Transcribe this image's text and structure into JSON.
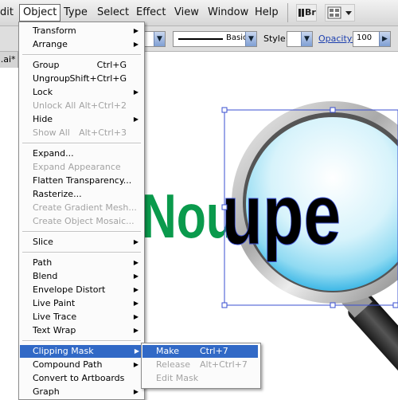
{
  "menubar": {
    "items": [
      "dit",
      "Object",
      "Type",
      "Select",
      "Effect",
      "View",
      "Window",
      "Help"
    ],
    "bridge_label": "Br"
  },
  "control_bar": {
    "stroke_profile": "Basic",
    "style_label": "Style:",
    "opacity_label": "Opacity:",
    "opacity_value": "100"
  },
  "document_tab": "a.ai*",
  "object_menu": {
    "items": [
      {
        "label": "Transform",
        "shortcut": "",
        "submenu": true,
        "disabled": false
      },
      {
        "label": "Arrange",
        "shortcut": "",
        "submenu": true,
        "disabled": false
      },
      {
        "label": "Group",
        "shortcut": "Ctrl+G",
        "submenu": false,
        "disabled": false
      },
      {
        "label": "Ungroup",
        "shortcut": "Shift+Ctrl+G",
        "submenu": false,
        "disabled": false
      },
      {
        "label": "Lock",
        "shortcut": "",
        "submenu": true,
        "disabled": false
      },
      {
        "label": "Unlock All",
        "shortcut": "Alt+Ctrl+2",
        "submenu": false,
        "disabled": true
      },
      {
        "label": "Hide",
        "shortcut": "",
        "submenu": true,
        "disabled": false
      },
      {
        "label": "Show All",
        "shortcut": "Alt+Ctrl+3",
        "submenu": false,
        "disabled": true
      },
      {
        "label": "Expand...",
        "shortcut": "",
        "submenu": false,
        "disabled": false
      },
      {
        "label": "Expand Appearance",
        "shortcut": "",
        "submenu": false,
        "disabled": true
      },
      {
        "label": "Flatten Transparency...",
        "shortcut": "",
        "submenu": false,
        "disabled": false
      },
      {
        "label": "Rasterize...",
        "shortcut": "",
        "submenu": false,
        "disabled": false
      },
      {
        "label": "Create Gradient Mesh...",
        "shortcut": "",
        "submenu": false,
        "disabled": true
      },
      {
        "label": "Create Object Mosaic...",
        "shortcut": "",
        "submenu": false,
        "disabled": true
      },
      {
        "label": "Slice",
        "shortcut": "",
        "submenu": true,
        "disabled": false
      },
      {
        "label": "Path",
        "shortcut": "",
        "submenu": true,
        "disabled": false
      },
      {
        "label": "Blend",
        "shortcut": "",
        "submenu": true,
        "disabled": false
      },
      {
        "label": "Envelope Distort",
        "shortcut": "",
        "submenu": true,
        "disabled": false
      },
      {
        "label": "Live Paint",
        "shortcut": "",
        "submenu": true,
        "disabled": false
      },
      {
        "label": "Live Trace",
        "shortcut": "",
        "submenu": true,
        "disabled": false
      },
      {
        "label": "Text Wrap",
        "shortcut": "",
        "submenu": true,
        "disabled": false
      },
      {
        "label": "Clipping Mask",
        "shortcut": "",
        "submenu": true,
        "disabled": false,
        "highlighted": true
      },
      {
        "label": "Compound Path",
        "shortcut": "",
        "submenu": true,
        "disabled": false
      },
      {
        "label": "Convert to Artboards",
        "shortcut": "",
        "submenu": false,
        "disabled": false
      },
      {
        "label": "Graph",
        "shortcut": "",
        "submenu": true,
        "disabled": false
      }
    ]
  },
  "clipping_submenu": {
    "items": [
      {
        "label": "Make",
        "shortcut": "Ctrl+7",
        "highlighted": true,
        "disabled": false
      },
      {
        "label": "Release",
        "shortcut": "Alt+Ctrl+7",
        "disabled": true
      },
      {
        "label": "Edit Mask",
        "shortcut": "",
        "disabled": true
      }
    ]
  },
  "artwork": {
    "green_text": "Nou",
    "black_text": "upe",
    "green_color": "#0a9a4c"
  },
  "colors": {
    "menu_highlight": "#3169c6",
    "selection": "#3a4fd1"
  }
}
